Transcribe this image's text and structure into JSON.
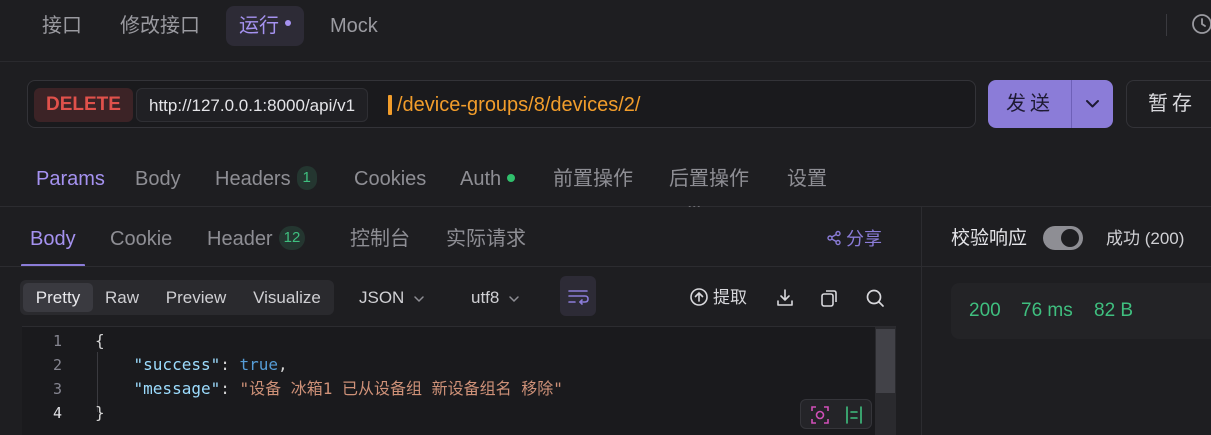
{
  "top_tabs": [
    "接口",
    "修改接口",
    "运行",
    "Mock"
  ],
  "request": {
    "method": "DELETE",
    "url_prefix": "http://127.0.0.1:8000/api/v1",
    "url_path": "/device-groups/8/devices/2/",
    "send_label": "发送",
    "save_label": "暂存"
  },
  "request_tabs": {
    "params": "Params",
    "body": "Body",
    "headers": "Headers",
    "headers_count": "1",
    "cookies": "Cookies",
    "auth": "Auth",
    "pre_ops": "前置操作",
    "post_ops": "后置操作",
    "settings": "设置"
  },
  "response_tabs": {
    "body": "Body",
    "cookie": "Cookie",
    "header": "Header",
    "header_count": "12",
    "console": "控制台",
    "actual_request": "实际请求",
    "share": "分享"
  },
  "view_modes": [
    "Pretty",
    "Raw",
    "Preview",
    "Visualize"
  ],
  "format": "JSON",
  "encoding": "utf8",
  "extract_label": "提取",
  "code": {
    "line_numbers": [
      "1",
      "2",
      "3",
      "4"
    ],
    "open_brace": "{",
    "success_key": "\"success\"",
    "success_value": "true",
    "message_key": "\"message\"",
    "message_value": "\"设备 冰箱1 已从设备组 新设备组名 移除\"",
    "close_brace": "}"
  },
  "verify": {
    "label": "校验响应",
    "result": "成功 (200)"
  },
  "stats": {
    "status": "200",
    "time": "76 ms",
    "size": "82 B"
  },
  "colors": {
    "accent": "#8b7cd8",
    "method_delete": "#e0514b",
    "url_path": "#f29d2b",
    "success_green": "#3fbf7f"
  }
}
